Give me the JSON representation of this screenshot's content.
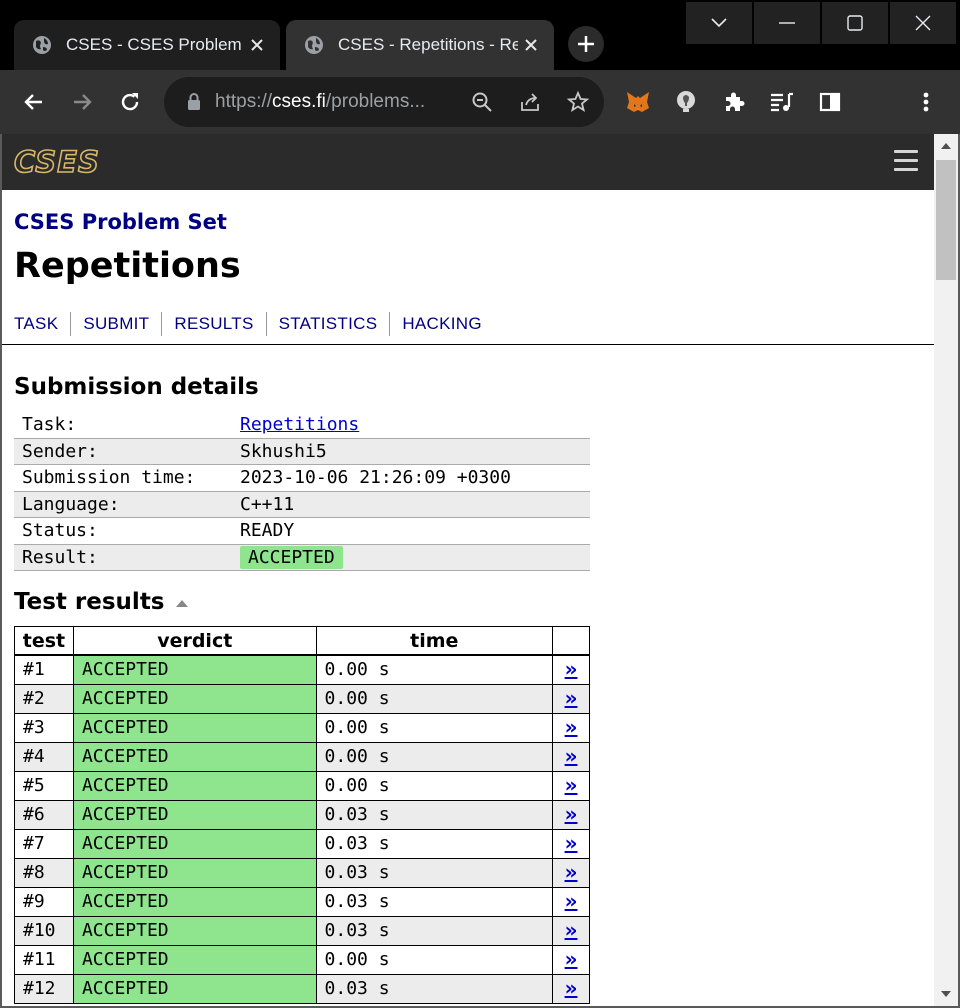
{
  "browser": {
    "tabs": [
      {
        "title": "CSES - CSES Problem Set",
        "active": false
      },
      {
        "title": "CSES - Repetitions - Results",
        "active": true
      }
    ],
    "url_prefix": "https://",
    "url_host": "cses.fi",
    "url_path": "/problems...",
    "extensions": [
      "metamask-fox-icon",
      "lightbulb-icon",
      "puzzle-extensions-icon",
      "media-queue-icon",
      "side-panel-icon"
    ]
  },
  "site": {
    "logo_text": "CSES"
  },
  "page": {
    "breadcrumb": "CSES Problem Set",
    "title": "Repetitions",
    "nav": [
      "TASK",
      "SUBMIT",
      "RESULTS",
      "STATISTICS",
      "HACKING"
    ]
  },
  "submission": {
    "heading": "Submission details",
    "rows": [
      {
        "key": "Task:",
        "value": "Repetitions"
      },
      {
        "key": "Sender:",
        "value": "Skhushi5"
      },
      {
        "key": "Submission time:",
        "value": "2023-10-06 21:26:09 +0300"
      },
      {
        "key": "Language:",
        "value": "C++11"
      },
      {
        "key": "Status:",
        "value": "READY"
      },
      {
        "key": "Result:",
        "value": "ACCEPTED"
      }
    ]
  },
  "tests": {
    "heading": "Test results",
    "columns": [
      "test",
      "verdict",
      "time",
      ""
    ],
    "link_glyph": "»",
    "rows": [
      {
        "test": "#1",
        "verdict": "ACCEPTED",
        "time": "0.00 s"
      },
      {
        "test": "#2",
        "verdict": "ACCEPTED",
        "time": "0.00 s"
      },
      {
        "test": "#3",
        "verdict": "ACCEPTED",
        "time": "0.00 s"
      },
      {
        "test": "#4",
        "verdict": "ACCEPTED",
        "time": "0.00 s"
      },
      {
        "test": "#5",
        "verdict": "ACCEPTED",
        "time": "0.00 s"
      },
      {
        "test": "#6",
        "verdict": "ACCEPTED",
        "time": "0.03 s"
      },
      {
        "test": "#7",
        "verdict": "ACCEPTED",
        "time": "0.03 s"
      },
      {
        "test": "#8",
        "verdict": "ACCEPTED",
        "time": "0.03 s"
      },
      {
        "test": "#9",
        "verdict": "ACCEPTED",
        "time": "0.03 s"
      },
      {
        "test": "#10",
        "verdict": "ACCEPTED",
        "time": "0.03 s"
      },
      {
        "test": "#11",
        "verdict": "ACCEPTED",
        "time": "0.00 s"
      },
      {
        "test": "#12",
        "verdict": "ACCEPTED",
        "time": "0.03 s"
      }
    ]
  },
  "colors": {
    "accepted": "#8ee58e",
    "link": "#0000cc",
    "heading_blue": "#000080"
  }
}
